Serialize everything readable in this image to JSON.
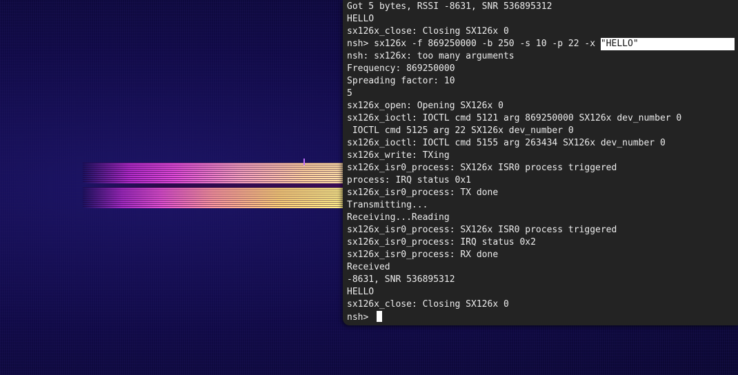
{
  "terminal": {
    "lines": [
      "Got 5 bytes, RSSI -8631, SNR 536895312",
      "HELLO",
      "sx126x_close: Closing SX126x 0",
      "nsh> sx126x -f 869250000 -b 250 -s 10 -p 22 -x ",
      "nsh: sx126x: too many arguments",
      "Frequency: 869250000",
      "Spreading factor: 10",
      "5",
      "sx126x_open: Opening SX126x 0",
      "sx126x_ioctl: IOCTL cmd 5121 arg 869250000 SX126x dev_number 0",
      " IOCTL cmd 5125 arg 22 SX126x dev_number 0",
      "sx126x_ioctl: IOCTL cmd 5155 arg 263434 SX126x dev_number 0",
      "sx126x_write: TXing",
      "sx126x_isr0_process: SX126x ISR0 process triggered",
      "process: IRQ status 0x1",
      "sx126x_isr0_process: TX done",
      "Transmitting...",
      "Receiving...Reading",
      "sx126x_isr0_process: SX126x ISR0 process triggered",
      "sx126x_isr0_process: IRQ status 0x2",
      "sx126x_isr0_process: RX done",
      "Received",
      "-8631, SNR 536895312",
      "HELLO",
      "sx126x_close: Closing SX126x 0"
    ],
    "selected_text": "\"HELLO\"",
    "prompt": "nsh> "
  },
  "colors": {
    "terminal_bg": "#232323",
    "terminal_text": "#ececec",
    "spectrogram_bg": "#0d0933"
  }
}
